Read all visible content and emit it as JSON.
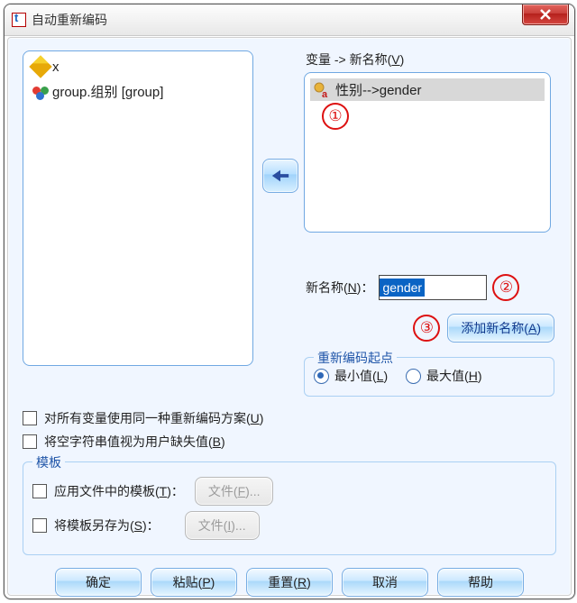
{
  "window": {
    "title": "自动重新编码"
  },
  "left_list": [
    {
      "icon": "ruler",
      "label": "x"
    },
    {
      "icon": "balls",
      "label": "group.组别 [group]"
    }
  ],
  "right": {
    "caption_pre": "变量 -> 新名称(",
    "caption_u": "V",
    "caption_post": ")",
    "items": [
      {
        "label": "性别-->gender",
        "selected": true
      }
    ]
  },
  "newname": {
    "label_pre": "新名称(",
    "label_u": "N",
    "label_post": ")：",
    "value": "gender"
  },
  "addname": {
    "label_pre": "添加新名称(",
    "label_u": "A",
    "label_post": ")"
  },
  "recode_start": {
    "legend": "重新编码起点",
    "min_pre": "最小值(",
    "min_u": "L",
    "min_post": ")",
    "max_pre": "最大值(",
    "max_u": "H",
    "max_post": ")",
    "selected": "min"
  },
  "checks": {
    "all_pre": "对所有变量使用同一种重新编码方案(",
    "all_u": "U",
    "all_post": ")",
    "blank_pre": "将空字符串值视为用户缺失值(",
    "blank_u": "B",
    "blank_post": ")"
  },
  "template": {
    "legend": "模板",
    "apply_pre": "应用文件中的模板(",
    "apply_u": "T",
    "apply_post": ")：",
    "apply_btn_pre": "文件(",
    "apply_btn_u": "F",
    "apply_btn_post": ")...",
    "save_pre": "将模板另存为(",
    "save_u": "S",
    "save_post": ")：",
    "save_btn_pre": "文件(",
    "save_btn_u": "I",
    "save_btn_post": ")..."
  },
  "buttons": {
    "ok": "确定",
    "paste_pre": "粘贴(",
    "paste_u": "P",
    "paste_post": ")",
    "reset_pre": "重置(",
    "reset_u": "R",
    "reset_post": ")",
    "cancel": "取消",
    "help": "帮助"
  },
  "steps": {
    "s1": "①",
    "s2": "②",
    "s3": "③"
  }
}
